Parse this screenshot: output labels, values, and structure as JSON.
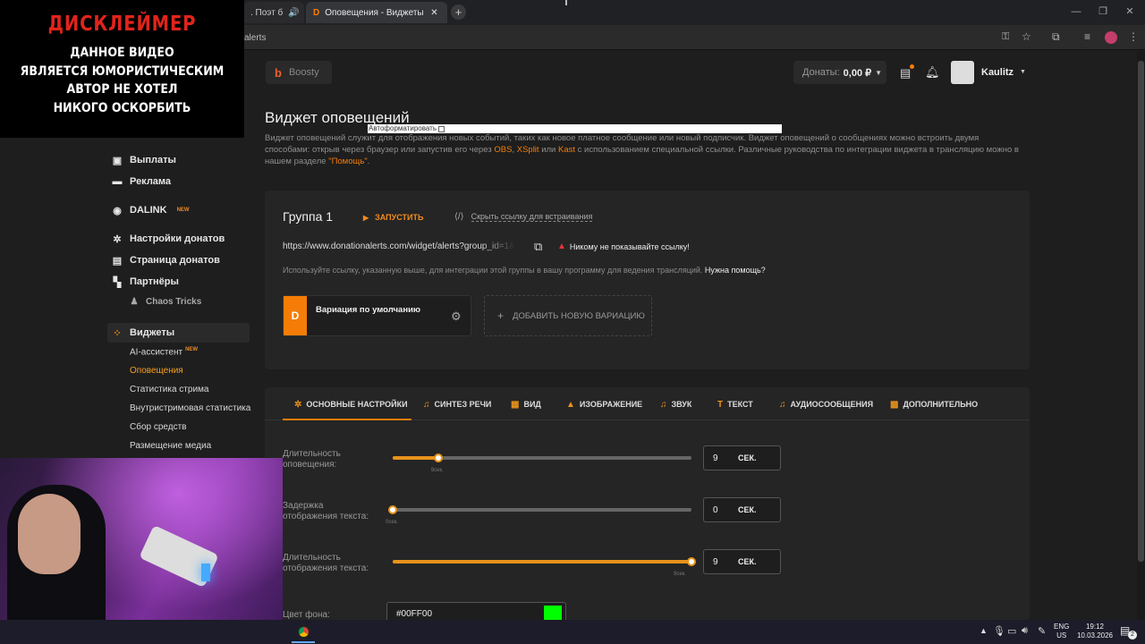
{
  "browser": {
    "tabs": [
      {
        "label": ". Поэт б",
        "icon": "speaker-icon"
      },
      {
        "label": "Оповещения - Виджеты - Do",
        "icon": "donationalerts-icon"
      }
    ],
    "address_fragment": "alerts"
  },
  "overlay": {
    "disclaimer_title": "ДИСКЛЕЙМЕР",
    "disclaimer_lines": [
      "ДАННОЕ ВИДЕО",
      "ЯВЛЯЕТСЯ ЮМОРИСТИЧЕСКИМ",
      "АВТОР НЕ ХОТЕЛ",
      "НИКОГО ОСКОРБИТЬ"
    ]
  },
  "header": {
    "boosty_label": "Boosty",
    "donations_label": "Донаты:",
    "donations_value": "0,00 ₽",
    "username": "Kaulitz"
  },
  "sidebar": {
    "items": [
      {
        "label": "Выплаты",
        "icon": "wallet-icon"
      },
      {
        "label": "Реклама",
        "icon": "megaphone-icon"
      },
      {
        "label": "DALINK",
        "icon": "dalink-icon",
        "badge": "NEW"
      },
      {
        "label": "Настройки донатов",
        "icon": "gear-icon"
      },
      {
        "label": "Страница донатов",
        "icon": "page-icon"
      },
      {
        "label": "Партнёры",
        "icon": "partners-icon"
      },
      {
        "label": "Chaos Tricks",
        "icon": "puzzle-icon"
      },
      {
        "label": "Виджеты",
        "icon": "widgets-icon"
      }
    ],
    "widget_subitems": [
      {
        "label": "AI-ассистент",
        "badge": "NEW"
      },
      {
        "label": "Оповещения"
      },
      {
        "label": "Статистика стрима"
      },
      {
        "label": "Внутристримовая статистика"
      },
      {
        "label": "Сбор средств"
      },
      {
        "label": "Размещение медиа"
      }
    ]
  },
  "page": {
    "title": "Виджет оповещений",
    "autoformat_label": "Автоформатировать",
    "desc_before": "Виджет оповещений служит для отображения новых событий, таких как новое платное сообщение или новый подписчик. Виджет оповещений о сообщениях можно встроить двумя способами: открыв через браузер или запустив его через ",
    "desc_obs": "OBS",
    "desc_comma": ", ",
    "desc_xsplit": "XSplit",
    "desc_or": " или ",
    "desc_kast": "Kast",
    "desc_mid": " с использованием специальной ссылки. Различные руководства по интеграции виджета в трансляцию можно в нашем разделе ",
    "desc_help": "\"Помощь\"",
    "desc_end": "."
  },
  "group": {
    "title": "Группа 1",
    "launch_label": "ЗАПУСТИТЬ",
    "hide_link_label": "Скрыть ссылку для встраивания",
    "url": "https://www.donationalerts.com/widget/alerts?group_id=1&t",
    "warning": "Никому не показывайте ссылку!",
    "hint": "Используйте ссылку, указанную выше, для интеграции этой группы в вашу программу для ведения трансляций.",
    "help_link": "Нужна помощь?",
    "variation_label": "Вариация по умолчанию",
    "add_variation_label": "ДОБАВИТЬ НОВУЮ ВАРИАЦИЮ"
  },
  "settings": {
    "tabs": [
      {
        "label": "ОСНОВНЫЕ НАСТРОЙКИ",
        "icon": "gear-icon"
      },
      {
        "label": "СИНТЕЗ РЕЧИ",
        "icon": "music-note-icon"
      },
      {
        "label": "ВИД",
        "icon": "film-icon"
      },
      {
        "label": "ИЗОБРАЖЕНИЕ",
        "icon": "image-icon"
      },
      {
        "label": "ЗВУК",
        "icon": "music-note-icon"
      },
      {
        "label": "ТЕКСТ",
        "icon": "text-icon"
      },
      {
        "label": "АУДИОСООБЩЕНИЯ",
        "icon": "music-note-icon"
      },
      {
        "label": "ДОПОЛНИТЕЛЬНО",
        "icon": "grid-icon"
      }
    ],
    "rows": [
      {
        "label_line1": "Длительность",
        "label_line2": "оповещения:",
        "value": "9",
        "unit": "СЕК.",
        "marker": "9сек.",
        "fraction": 0.152
      },
      {
        "label_line1": "Задержка",
        "label_line2": "отображения текста:",
        "value": "0",
        "unit": "СЕК.",
        "marker": "0сек.",
        "fraction": 0.0
      },
      {
        "label_line1": "Длительность",
        "label_line2": "отображения текста:",
        "value": "9",
        "unit": "СЕК.",
        "marker": "9сек.",
        "fraction": 1.0
      }
    ],
    "bg_color_label": "Цвет фона:",
    "bg_color_value": "#00FF00"
  },
  "taskbar": {
    "lang_line1": "ENG",
    "lang_line2": "US",
    "time": "19:12",
    "date": "10.03.2026",
    "notif_count": "2"
  }
}
